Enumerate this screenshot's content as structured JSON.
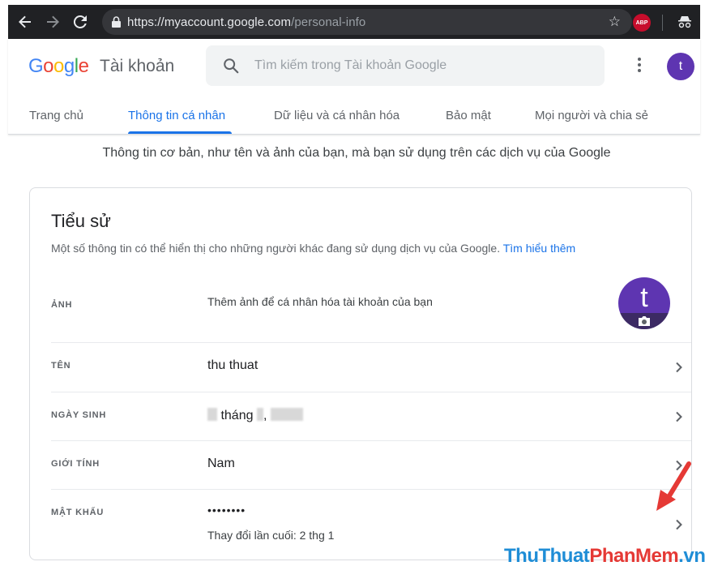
{
  "browser": {
    "url_host": "https://myaccount.google.com",
    "url_path": "/personal-info"
  },
  "header": {
    "logo_letters": [
      "G",
      "o",
      "o",
      "g",
      "l",
      "e"
    ],
    "product": "Tài khoản",
    "search_placeholder": "Tìm kiếm trong Tài khoản Google",
    "avatar_letter": "t"
  },
  "tabs": [
    {
      "label": "Trang chủ",
      "active": false
    },
    {
      "label": "Thông tin cá nhân",
      "active": true
    },
    {
      "label": "Dữ liệu và cá nhân hóa",
      "active": false
    },
    {
      "label": "Bảo mật",
      "active": false
    },
    {
      "label": "Mọi người và chia sẻ",
      "active": false
    }
  ],
  "intro": "Thông tin cơ bản, như tên và ảnh của bạn, mà bạn sử dụng trên các dịch vụ của Google",
  "profile": {
    "title": "Tiểu sử",
    "description": "Một số thông tin có thể hiển thị cho những người khác đang sử dụng dịch vụ của Google.",
    "learn_more": "Tìm hiểu thêm",
    "photo": {
      "label": "ẢNH",
      "value": "Thêm ảnh để cá nhân hóa tài khoản của bạn",
      "avatar_letter": "t"
    },
    "name": {
      "label": "TÊN",
      "value": "thu thuat"
    },
    "birthday": {
      "label": "NGÀY SINH",
      "month_word": "tháng",
      "separator": ","
    },
    "gender": {
      "label": "GIỚI TÍNH",
      "value": "Nam"
    },
    "password": {
      "label": "MẬT KHẨU",
      "value": "••••••••",
      "last_changed": "Thay đổi lần cuối: 2 thg 1"
    }
  },
  "watermark": {
    "part1": "ThuThuat",
    "part2": "PhanMem",
    "part3": ".vn"
  },
  "colors": {
    "accent": "#1a73e8",
    "avatar": "#5e35b1",
    "arrow": "#e53935"
  }
}
